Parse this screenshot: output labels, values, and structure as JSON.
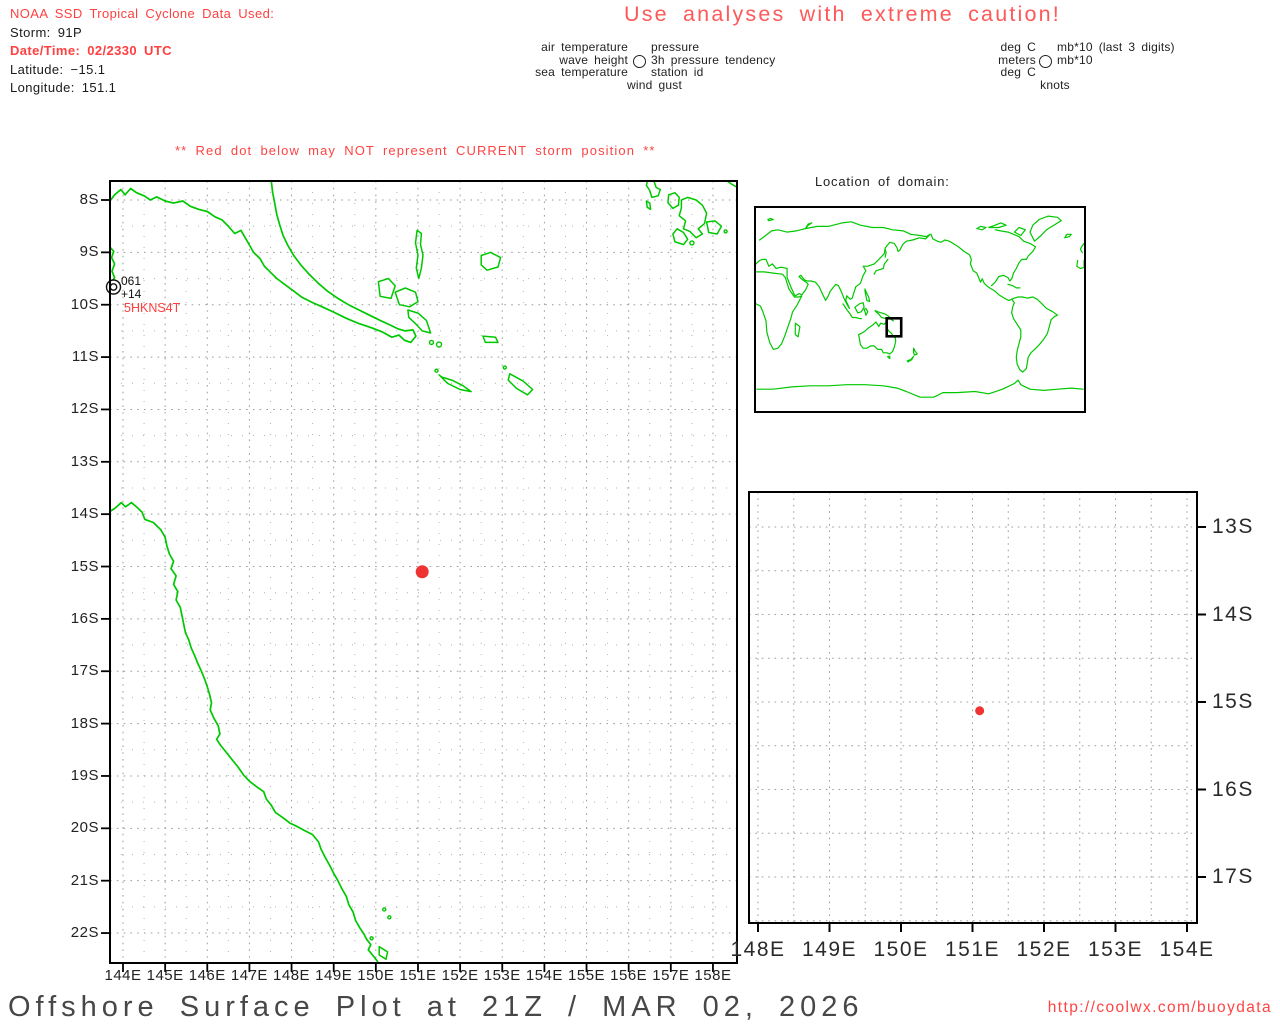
{
  "header": {
    "source_title": "NOAA SSD Tropical Cyclone Data Used:",
    "storm": "Storm: 91P",
    "datetime": "Date/Time: 02/2330 UTC",
    "latitude": "Latitude: −15.1",
    "longitude": "Longitude: 151.1"
  },
  "caution": "Use analyses with extreme caution!",
  "station_model_legend": {
    "left": [
      "air temperature",
      "wave height",
      "sea temperature"
    ],
    "below": "wind gust",
    "right": [
      "pressure",
      "3h pressure tendency",
      "station id"
    ]
  },
  "units_legend": {
    "left": [
      "deg C",
      "meters",
      "deg C"
    ],
    "below": "knots",
    "right": [
      "mb*10 (last 3 digits)",
      "mb*10"
    ]
  },
  "warning": "** Red dot below may NOT represent CURRENT storm position **",
  "main_map": {
    "lat_ticks": [
      "8S",
      "9S",
      "10S",
      "11S",
      "12S",
      "13S",
      "14S",
      "15S",
      "16S",
      "17S",
      "18S",
      "19S",
      "20S",
      "21S",
      "22S"
    ],
    "lon_ticks": [
      "144E",
      "145E",
      "146E",
      "147E",
      "148E",
      "149E",
      "150E",
      "151E",
      "152E",
      "153E",
      "154E",
      "155E",
      "156E",
      "157E",
      "158E"
    ],
    "station": {
      "pressure": "061",
      "tendency": "+14",
      "id": "5HKNS4T"
    },
    "storm_dot": {
      "lon_e": 151.1,
      "lat_s": 15.1
    }
  },
  "inset_map": {
    "title": "Location of domain:"
  },
  "zoom_map": {
    "lat_ticks": [
      "13S",
      "14S",
      "15S",
      "16S",
      "17S"
    ],
    "lon_ticks": [
      "148E",
      "149E",
      "150E",
      "151E",
      "152E",
      "153E",
      "154E"
    ],
    "storm_dot": {
      "lon_e": 151.1,
      "lat_s": 15.1
    }
  },
  "footer": {
    "title": "Offshore Surface Plot at 21Z / MAR 02, 2026",
    "url": "http://coolwx.com/buoydata"
  },
  "colors": {
    "coast_green": "#00c800",
    "storm_red": "#ee3333",
    "grid_gray": "#9c9c9c",
    "grid_gray_light": "#b3b3b3",
    "frame_black": "#000000",
    "station_black": "#111111",
    "station_id_red": "#ff4040"
  }
}
